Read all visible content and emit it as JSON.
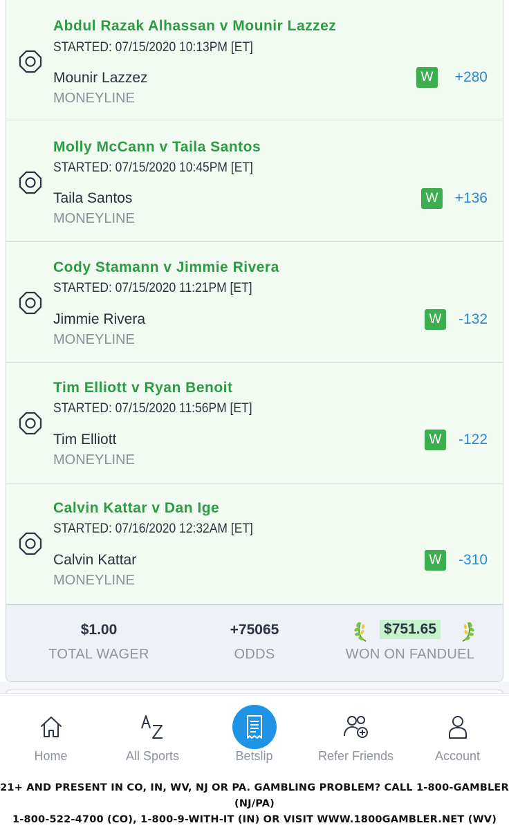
{
  "legs": [
    {
      "title": "Abdul Razak Alhassan v Mounir Lazzez",
      "started": "STARTED: 07/15/2020 10:13PM [ET]",
      "selection": "Mounir Lazzez",
      "market": "MONEYLINE",
      "result": "W",
      "odds": "+280"
    },
    {
      "title": "Molly McCann v Taila Santos",
      "started": "STARTED: 07/15/2020 10:45PM [ET]",
      "selection": "Taila Santos",
      "market": "MONEYLINE",
      "result": "W",
      "odds": "+136"
    },
    {
      "title": "Cody Stamann v Jimmie Rivera",
      "started": "STARTED: 07/15/2020 11:21PM [ET]",
      "selection": "Jimmie Rivera",
      "market": "MONEYLINE",
      "result": "W",
      "odds": "-132"
    },
    {
      "title": "Tim Elliott v Ryan Benoit",
      "started": "STARTED: 07/15/2020 11:56PM [ET]",
      "selection": "Tim Elliott",
      "market": "MONEYLINE",
      "result": "W",
      "odds": "-122"
    },
    {
      "title": "Calvin Kattar v Dan Ige",
      "started": "STARTED: 07/16/2020 12:32AM [ET]",
      "selection": "Calvin Kattar",
      "market": "MONEYLINE",
      "result": "W",
      "odds": "-310"
    }
  ],
  "summary": {
    "wager_value": "$1.00",
    "wager_label": "TOTAL WAGER",
    "odds_value": "+75065",
    "odds_label": "ODDS",
    "won_value": "$751.65",
    "won_label": "WON ON FANDUEL"
  },
  "tabs": [
    {
      "label": "Home",
      "icon": "home-icon"
    },
    {
      "label": "All Sports",
      "icon": "az-icon"
    },
    {
      "label": "Betslip",
      "icon": "betslip-icon"
    },
    {
      "label": "Refer Friends",
      "icon": "refer-friends-icon"
    },
    {
      "label": "Account",
      "icon": "account-icon"
    }
  ],
  "disclaimer": {
    "line1": "21+ AND PRESENT IN CO, IN, WV, NJ OR PA. GAMBLING PROBLEM? CALL 1-800-GAMBLER (NJ/PA)",
    "line2": "1-800-522-4700 (CO), 1-800-9-WITH-IT (IN) OR VISIT WWW.1800GAMBLER.NET (WV)"
  },
  "colors": {
    "leg_background": "#f1fbf1",
    "title_green": "#2f9a44",
    "win_badge": "#3dae4f",
    "odds_blue": "#2c88d6",
    "betslip_blue": "#1f93e6",
    "won_highlight": "#c8f1cd"
  }
}
